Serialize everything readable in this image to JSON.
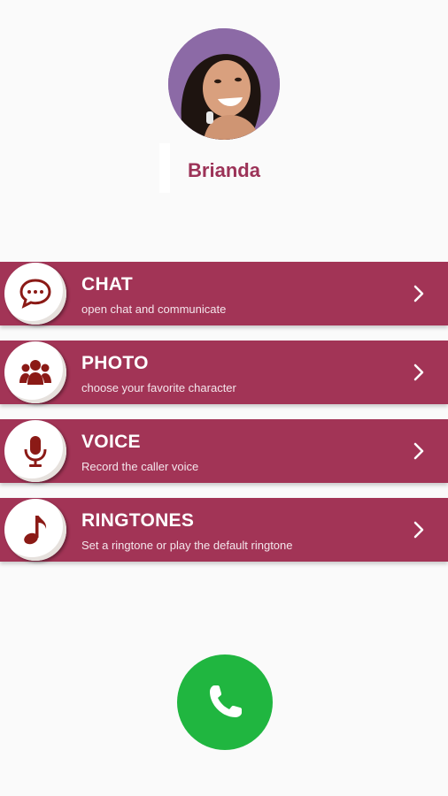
{
  "contact": {
    "name": "Brianda"
  },
  "menu": [
    {
      "id": "chat",
      "icon": "chat-bubble-icon",
      "title": "CHAT",
      "subtitle": "open chat and communicate"
    },
    {
      "id": "photo",
      "icon": "people-group-icon",
      "title": "PHOTO",
      "subtitle": "choose your favorite character"
    },
    {
      "id": "voice",
      "icon": "microphone-icon",
      "title": "VOICE",
      "subtitle": "Record the caller voice"
    },
    {
      "id": "ringtones",
      "icon": "music-note-icon",
      "title": "RINGTONES",
      "subtitle": "Set a ringtone or play the default ringtone"
    }
  ],
  "colors": {
    "accent": "#a23456",
    "name_text": "#9c3358",
    "icon_fill": "#8b1a16",
    "call_button": "#20b640",
    "background": "#fafafa"
  },
  "call_button": {
    "icon": "phone-icon"
  }
}
